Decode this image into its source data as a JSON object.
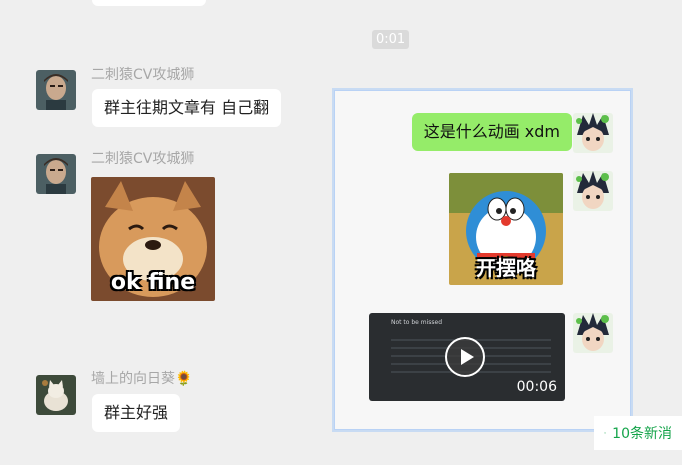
{
  "top_time": "0:01",
  "chat_left": {
    "msg1": {
      "sender": "二刺猿CV攻城狮",
      "text": "群主往期文章有 自己翻"
    },
    "msg2": {
      "sender": "二刺猿CV攻城狮",
      "sticker_text": "ok fine"
    },
    "msg3": {
      "sender": "墙上的向日葵",
      "sender_emoji": "🌻",
      "text": "群主好强"
    }
  },
  "panel": {
    "msg1": {
      "text": "这是什么动画 xdm"
    },
    "msg2": {
      "sticker_text": "开摆咯"
    },
    "msg3": {
      "video_header": "Not to be missed",
      "video_duration": "00:06"
    }
  },
  "new_messages": {
    "icon": "double-chevron-down-icon",
    "label": "10条新消"
  },
  "colors": {
    "accent_green": "#95ec69",
    "link_green": "#14a44a",
    "panel_border": "#b9d2f5"
  }
}
